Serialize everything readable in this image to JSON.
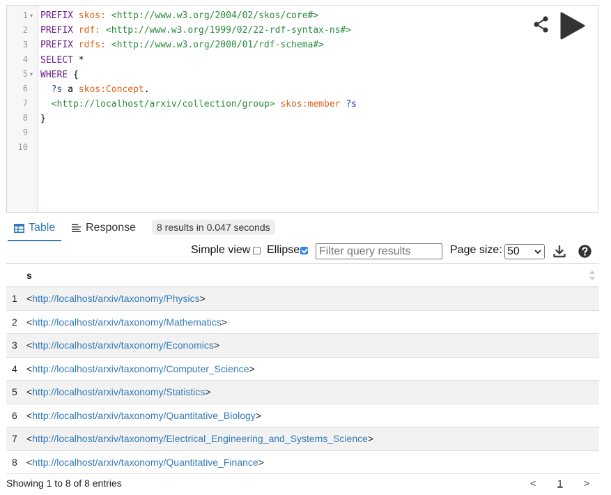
{
  "editor": {
    "line_numbers": [
      "1",
      "2",
      "3",
      "4",
      "5",
      "6",
      "7",
      "8",
      "9",
      "10"
    ],
    "fold_marker": "▾",
    "lines": {
      "l1": {
        "kw": "PREFIX ",
        "pfx": "skos:",
        "iri": " <http://www.w3.org/2004/02/skos/core#>"
      },
      "l2": {
        "kw": "PREFIX ",
        "pfx": "rdf:",
        "iri": " <http://www.w3.org/1999/02/22-rdf-syntax-ns#>"
      },
      "l3": {
        "kw": "PREFIX ",
        "pfx": "rdfs:",
        "iri": " <http://www.w3.org/2000/01/rdf-schema#>"
      },
      "l4": {
        "kw": "SELECT",
        "rest": " *"
      },
      "l5": {
        "kw": "WHERE",
        "rest": " {"
      },
      "l6": {
        "indent": "  ",
        "var": "?s",
        "mid": " a ",
        "pfx": "skos:Concept",
        "end": "."
      },
      "l7": {
        "indent": "  ",
        "iri": "<http://localhost/arxiv/collection/group>",
        "sp": " ",
        "pfx": "skos:member",
        "sp2": " ",
        "var": "?s"
      },
      "l8": {
        "rest": "}"
      }
    },
    "share_icon": "share-icon",
    "run_icon": "play-icon"
  },
  "tabs": {
    "table_label": "Table",
    "response_label": "Response",
    "result_badge": "8 results in 0.047 seconds"
  },
  "controls": {
    "simple_view_label": "Simple view",
    "simple_view_checked": false,
    "ellipse_label": "Ellipse",
    "ellipse_checked": true,
    "filter_placeholder": "Filter query results",
    "page_size_label": "Page size:",
    "page_size_value": "50"
  },
  "table": {
    "column": "s",
    "rows": [
      {
        "idx": "1",
        "lt": "<",
        "link": "http://localhost/arxiv/taxonomy/Physics",
        "gt": ">"
      },
      {
        "idx": "2",
        "lt": "<",
        "link": "http://localhost/arxiv/taxonomy/Mathematics",
        "gt": ">"
      },
      {
        "idx": "3",
        "lt": "<",
        "link": "http://localhost/arxiv/taxonomy/Economics",
        "gt": ">"
      },
      {
        "idx": "4",
        "lt": "<",
        "link": "http://localhost/arxiv/taxonomy/Computer_Science",
        "gt": ">"
      },
      {
        "idx": "5",
        "lt": "<",
        "link": "http://localhost/arxiv/taxonomy/Statistics",
        "gt": ">"
      },
      {
        "idx": "6",
        "lt": "<",
        "link": "http://localhost/arxiv/taxonomy/Quantitative_Biology",
        "gt": ">"
      },
      {
        "idx": "7",
        "lt": "<",
        "link": "http://localhost/arxiv/taxonomy/Electrical_Engineering_and_Systems_Science",
        "gt": ">"
      },
      {
        "idx": "8",
        "lt": "<",
        "link": "http://localhost/arxiv/taxonomy/Quantitative_Finance",
        "gt": ">"
      }
    ]
  },
  "footer": {
    "info": "Showing 1 to 8 of 8 entries",
    "prev": "<",
    "current_page": "1",
    "next": ">"
  },
  "colors": {
    "keyword": "#6a1c8a",
    "prefix": "#e0621a",
    "iri": "#2b8a3e",
    "variable": "#1c3f95",
    "link": "#337ab7"
  }
}
